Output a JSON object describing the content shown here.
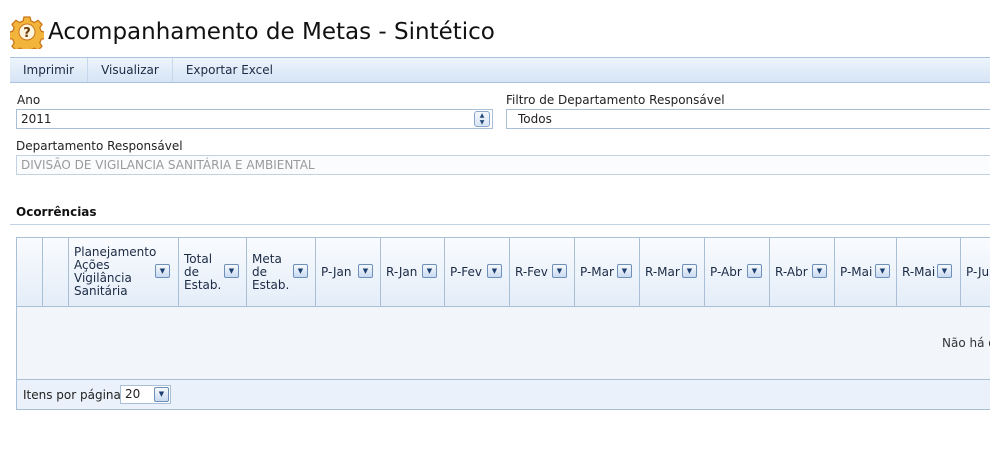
{
  "page": {
    "title": "Acompanhamento de Metas - Sintético"
  },
  "toolbar": {
    "print_label": "Imprimir",
    "view_label": "Visualizar",
    "export_label": "Exportar Excel"
  },
  "filters": {
    "year_label": "Ano",
    "year_value": "2011",
    "dept_filter_label": "Filtro de Departamento Responsável",
    "dept_filter_value": "Todos",
    "dept_label": "Departamento Responsável",
    "dept_value": "DIVISÃO DE VIGILANCIA SANITÁRIA E AMBIENTAL"
  },
  "section": {
    "title": "Ocorrências"
  },
  "grid": {
    "columns": [
      {
        "label": ""
      },
      {
        "label": ""
      },
      {
        "label": "Planejamento Ações Vigilância Sanitária"
      },
      {
        "label": "Total de Estab."
      },
      {
        "label": "Meta de Estab."
      },
      {
        "label": "P-Jan"
      },
      {
        "label": "R-Jan"
      },
      {
        "label": "P-Fev"
      },
      {
        "label": "R-Fev"
      },
      {
        "label": "P-Mar"
      },
      {
        "label": "R-Mar"
      },
      {
        "label": "P-Abr"
      },
      {
        "label": "R-Abr"
      },
      {
        "label": "P-Mai"
      },
      {
        "label": "R-Mai"
      },
      {
        "label": "P-Jun"
      }
    ],
    "empty_message": "Não há dados"
  },
  "pager": {
    "items_per_page_label": "Itens por página:",
    "items_per_page_value": "20"
  },
  "colors": {
    "accent": "#d6e4f5",
    "border": "#a9bfd6",
    "icon": "#e8962a"
  },
  "icons": {
    "title": "gear-question-icon",
    "spinner": "up-down-spinner-icon",
    "column_menu": "chevron-down-icon"
  }
}
